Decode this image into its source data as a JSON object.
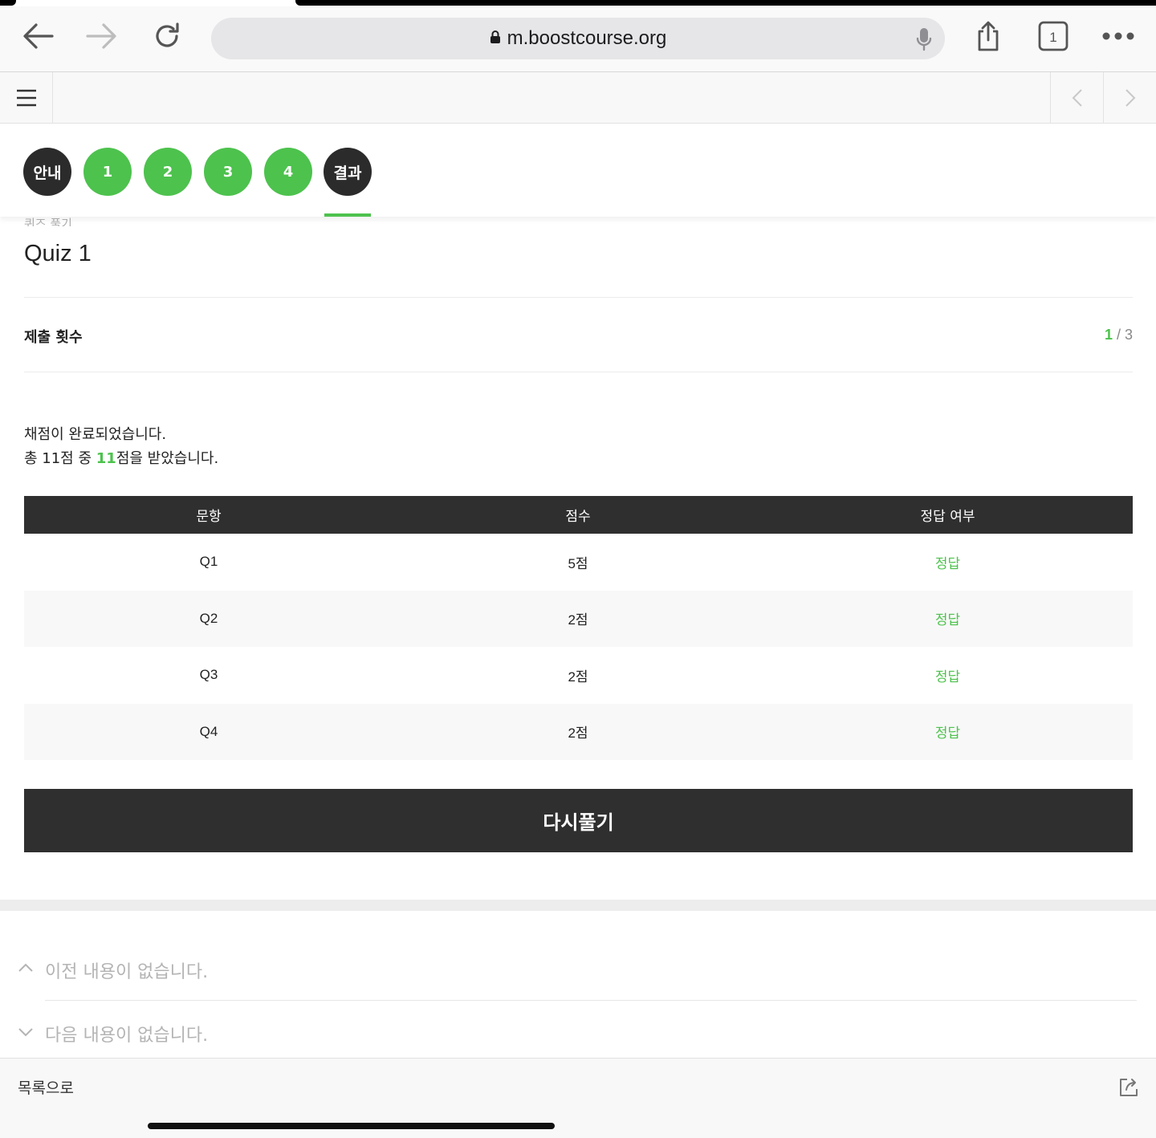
{
  "browser": {
    "url": "m.boostcourse.org",
    "tab_count": "1",
    "icons": [
      "back-arrow-icon",
      "forward-arrow-icon",
      "reload-icon",
      "lock-icon",
      "microphone-icon",
      "share-icon",
      "tabs-icon",
      "more-icon"
    ]
  },
  "navbar": {
    "icons": [
      "hamburger-menu-icon",
      "chevron-left-icon",
      "chevron-right-icon"
    ]
  },
  "steps": [
    {
      "label": "안내",
      "style": "dark"
    },
    {
      "label": "1",
      "style": "green"
    },
    {
      "label": "2",
      "style": "green"
    },
    {
      "label": "3",
      "style": "green"
    },
    {
      "label": "4",
      "style": "green"
    },
    {
      "label": "결과",
      "style": "dark",
      "active": true
    }
  ],
  "quiz": {
    "subtitle": "퀴즈 풀기",
    "title": "Quiz 1",
    "submission_label": "제출 횟수",
    "submission_current": "1",
    "submission_sep": " / ",
    "submission_total": "3",
    "message_line1": "채점이 완료되었습니다.",
    "message_line2_pre": "총 11점 중 ",
    "message_line2_score": "11",
    "message_line2_post": "점을 받았습니다."
  },
  "results_table": {
    "headers": [
      "문항",
      "점수",
      "정답 여부"
    ],
    "rows": [
      [
        "Q1",
        "5점",
        "정답"
      ],
      [
        "Q2",
        "2점",
        "정답"
      ],
      [
        "Q3",
        "2점",
        "정답"
      ],
      [
        "Q4",
        "2점",
        "정답"
      ]
    ]
  },
  "retry_button": "다시풀기",
  "pager": {
    "prev_text": "이전 내용이 없습니다.",
    "next_text": "다음 내용이 없습니다."
  },
  "bottom": {
    "to_list": "목록으로",
    "icons": [
      "external-share-icon"
    ]
  },
  "colors": {
    "accent_green": "#4dc24d",
    "dark": "#2f2f2f"
  }
}
